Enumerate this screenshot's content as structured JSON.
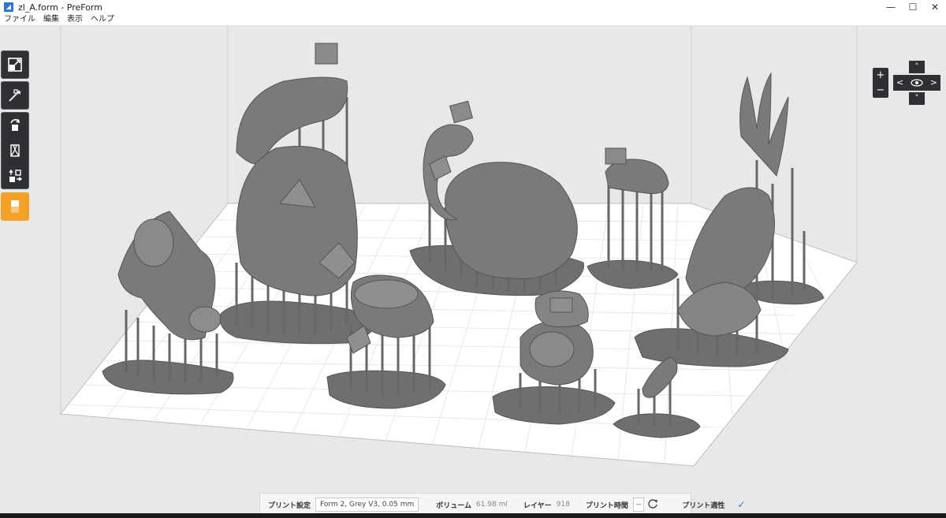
{
  "window": {
    "title": "zl_A.form - PreForm",
    "icon": "preform-app-icon",
    "controls": [
      "—",
      "☐",
      "✕"
    ]
  },
  "menu": {
    "items": [
      "ファイル",
      "編集",
      "表示",
      "ヘルプ"
    ]
  },
  "toolbar": {
    "tools": [
      "fit-view-icon",
      "magic-wand-icon",
      "rotate-icon",
      "supports-icon",
      "layout-icon",
      "printer-orange-icon"
    ]
  },
  "view_controls": {
    "zoom_in": "+",
    "zoom_out": "−",
    "nav_up": "˄",
    "nav_down": "˅",
    "nav_left": "<",
    "nav_right": ">",
    "nav_center": "eye-icon"
  },
  "bottom_bar": {
    "print_settings_label": "プリント設定",
    "print_settings_value": "Form 2, Grey V3, 0.05 mm",
    "volume_label": "ボリューム",
    "volume_value": "61.98 ml",
    "layer_label": "レイヤー",
    "layer_value": "918",
    "print_time_label": "プリント時間",
    "print_time_value": "--",
    "printability_label": "プリント適性",
    "check_icon": "check-icon",
    "refresh_icon": "refresh-icon"
  },
  "colors": {
    "accent_orange": "#f4a127",
    "toolbar_dark": "#2e3034",
    "model_grey": "#7a7a7a",
    "check_blue": "#2b78d8"
  }
}
